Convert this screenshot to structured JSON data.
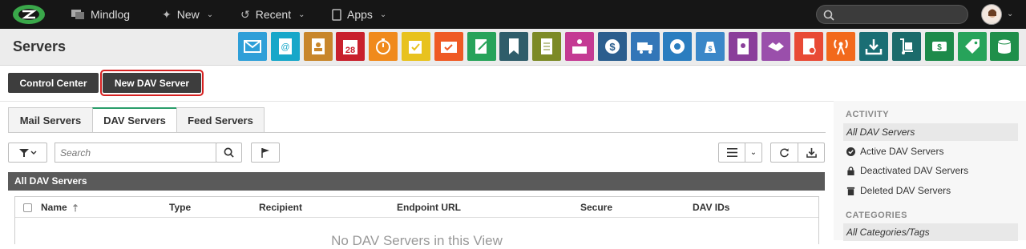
{
  "topbar": {
    "app_name": "Mindlog",
    "new_label": "New",
    "recent_label": "Recent",
    "apps_label": "Apps",
    "search_placeholder": ""
  },
  "header": {
    "title": "Servers",
    "app_icons": [
      {
        "name": "mail-icon",
        "color": "#2f9fd8"
      },
      {
        "name": "at-book-icon",
        "color": "#17a7c9"
      },
      {
        "name": "contacts-icon",
        "color": "#c8862b"
      },
      {
        "name": "calendar-icon",
        "color": "#c8202c"
      },
      {
        "name": "stopwatch-icon",
        "color": "#f08a1c"
      },
      {
        "name": "tasks-icon",
        "color": "#e8c21e"
      },
      {
        "name": "folder-check-icon",
        "color": "#ef5a24"
      },
      {
        "name": "notes-icon",
        "color": "#27a35a"
      },
      {
        "name": "bookmark-icon",
        "color": "#2f5d6a"
      },
      {
        "name": "document-icon",
        "color": "#7c8a26"
      },
      {
        "name": "register-icon",
        "color": "#c43a93"
      },
      {
        "name": "dollar-icon",
        "color": "#2b5e8e"
      },
      {
        "name": "truck-icon",
        "color": "#3276b8"
      },
      {
        "name": "support-icon",
        "color": "#2a7dbf"
      },
      {
        "name": "money-bag-icon",
        "color": "#3a87c8"
      },
      {
        "name": "award-icon",
        "color": "#8a3e9a"
      },
      {
        "name": "handshake-icon",
        "color": "#9a4fab"
      },
      {
        "name": "contract-icon",
        "color": "#e84a35"
      },
      {
        "name": "broadcast-icon",
        "color": "#f2691c"
      },
      {
        "name": "download-icon",
        "color": "#1a6e74"
      },
      {
        "name": "hand-truck-icon",
        "color": "#1b6b6b"
      },
      {
        "name": "cash-stack-icon",
        "color": "#1d8a4a"
      },
      {
        "name": "price-tag-icon",
        "color": "#27a35a"
      },
      {
        "name": "database-icon",
        "color": "#1f8f4a"
      }
    ]
  },
  "actions": {
    "control_center": "Control Center",
    "new_dav_server": "New DAV Server"
  },
  "tabs": [
    {
      "label": "Mail Servers"
    },
    {
      "label": "DAV Servers"
    },
    {
      "label": "Feed Servers"
    }
  ],
  "toolbar": {
    "search_placeholder": "Search"
  },
  "grid": {
    "title": "All DAV Servers",
    "columns": [
      "Name",
      "Type",
      "Recipient",
      "Endpoint URL",
      "Secure",
      "DAV IDs"
    ],
    "empty_text": "No DAV Servers in this View"
  },
  "sidebar": {
    "activity_heading": "ACTIVITY",
    "activity_items": [
      {
        "label": "All DAV Servers"
      },
      {
        "label": "Active DAV Servers"
      },
      {
        "label": "Deactivated DAV Servers"
      },
      {
        "label": "Deleted DAV Servers"
      }
    ],
    "categories_heading": "CATEGORIES",
    "categories_items": [
      {
        "label": "All Categories/Tags"
      }
    ]
  }
}
